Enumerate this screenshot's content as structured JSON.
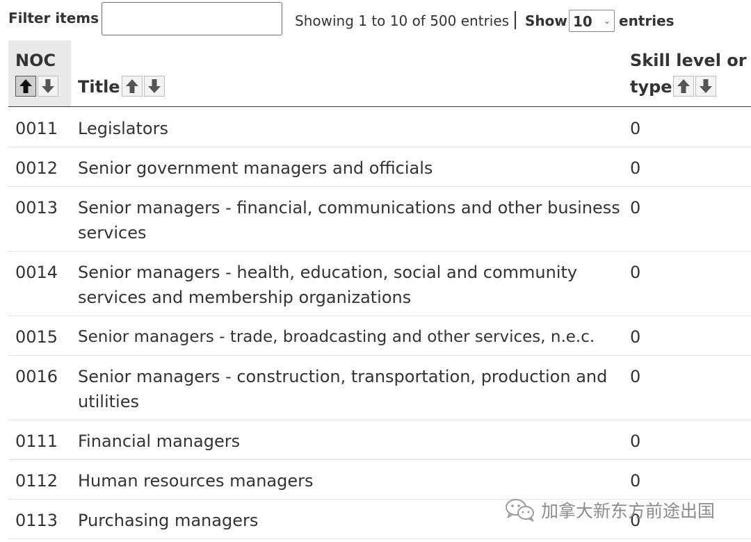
{
  "toolbar": {
    "filter_label": "Filter items",
    "filter_value": "",
    "info": "Showing 1 to 10 of 500 entries",
    "show_label": "Show",
    "page_size": "10",
    "entries_label": "entries"
  },
  "table": {
    "headers": {
      "noc": "NOC",
      "title": "Title",
      "skill_line1": "Skill level or",
      "skill_line2": "type"
    },
    "rows": [
      {
        "noc": "0011",
        "title": "Legislators",
        "skill": "0"
      },
      {
        "noc": "0012",
        "title": "Senior government managers and officials",
        "skill": "0"
      },
      {
        "noc": "0013",
        "title": "Senior managers - financial, communications and other business services",
        "skill": "0"
      },
      {
        "noc": "0014",
        "title": "Senior managers - health, education, social and community services and membership organizations",
        "skill": "0"
      },
      {
        "noc": "0015",
        "title": "Senior managers - trade, broadcasting and other services, n.e.c.",
        "skill": "0"
      },
      {
        "noc": "0016",
        "title": "Senior managers - construction, transportation, production and utilities",
        "skill": "0"
      },
      {
        "noc": "0111",
        "title": "Financial managers",
        "skill": "0"
      },
      {
        "noc": "0112",
        "title": "Human resources managers",
        "skill": "0"
      },
      {
        "noc": "0113",
        "title": "Purchasing managers",
        "skill": "0"
      }
    ]
  },
  "watermark": {
    "text": "加拿大新东方前途出国",
    "icon": "wechat-icon"
  }
}
